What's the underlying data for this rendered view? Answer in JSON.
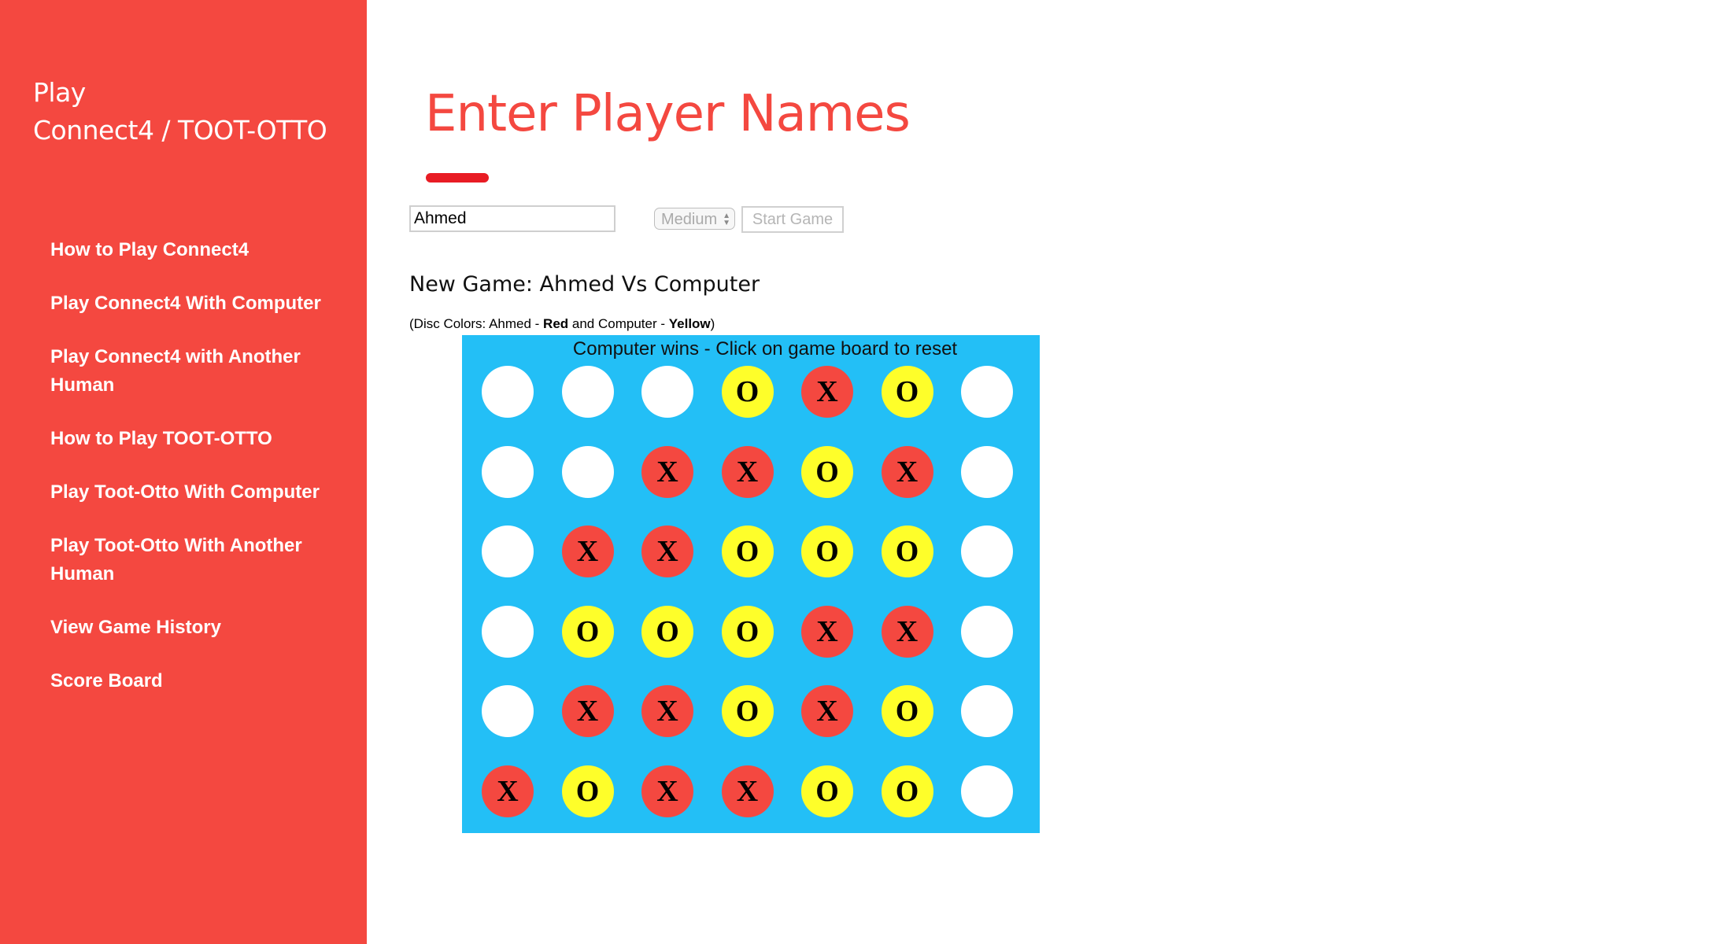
{
  "sidebar": {
    "brand_line1": "Play",
    "brand_line2": "Connect4 / TOOT-OTTO",
    "items": [
      {
        "label": "How to Play Connect4"
      },
      {
        "label": "Play Connect4 With Computer"
      },
      {
        "label": "Play Connect4 with Another Human"
      },
      {
        "label": "How to Play TOOT-OTTO"
      },
      {
        "label": "Play Toot-Otto With Computer"
      },
      {
        "label": "Play Toot-Otto With Another Human"
      },
      {
        "label": "View Game History"
      },
      {
        "label": "Score Board"
      }
    ]
  },
  "main": {
    "title": "Enter Player Names",
    "form": {
      "name_value": "Ahmed",
      "difficulty": "Medium",
      "start_label": "Start Game"
    },
    "new_game": "New Game: Ahmed Vs Computer",
    "disc_colors": {
      "prefix": "(Disc Colors: Ahmed - ",
      "player_color": "Red",
      "middle": " and Computer - ",
      "computer_color": "Yellow",
      "suffix": ")"
    }
  },
  "board": {
    "status": "Computer wins - Click on game board to reset",
    "colors": {
      "board": "#23bff6",
      "empty": "#ffffff",
      "red": "#f44840",
      "yellow": "#fefe2a"
    },
    "rows": [
      [
        " ",
        " ",
        " ",
        "O",
        "X",
        "O",
        " "
      ],
      [
        " ",
        " ",
        "X",
        "X",
        "O",
        "X",
        " "
      ],
      [
        " ",
        "X",
        "X",
        "O",
        "O",
        "O",
        " "
      ],
      [
        " ",
        "O",
        "O",
        "O",
        "X",
        "X",
        " "
      ],
      [
        " ",
        "X",
        "X",
        "O",
        "X",
        "O",
        " "
      ],
      [
        "X",
        "O",
        "X",
        "X",
        "O",
        "O",
        " "
      ]
    ]
  }
}
